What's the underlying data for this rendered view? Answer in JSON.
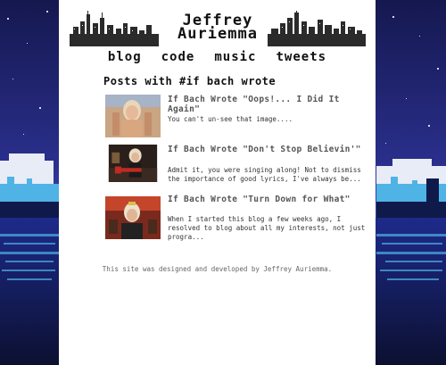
{
  "site": {
    "title": "Jeffrey\nAuriemma"
  },
  "nav": {
    "items": [
      "blog",
      "code",
      "music",
      "tweets"
    ]
  },
  "section": {
    "title": "Posts with #if bach wrote"
  },
  "posts": [
    {
      "title": "If Bach Wrote \"Oops!... I Did It Again\"",
      "excerpt": "You can't un-see that image...."
    },
    {
      "title": "If Bach Wrote \"Don't Stop Believin'\"",
      "excerpt": "Admit it, you were singing along! Not to dismiss the importance of good lyrics, I've always be..."
    },
    {
      "title": "If Bach Wrote \"Turn Down for What\"",
      "excerpt": "When I started this blog a few weeks ago, I resolved to blog about all my interests, not just progra..."
    }
  ],
  "footer": {
    "text": "This site was designed and developed by Jeffrey Auriemma."
  },
  "colors": {
    "sky": "#1b1f63",
    "city_glow": "#4fb3e6",
    "page_bg": "#ffffff"
  }
}
